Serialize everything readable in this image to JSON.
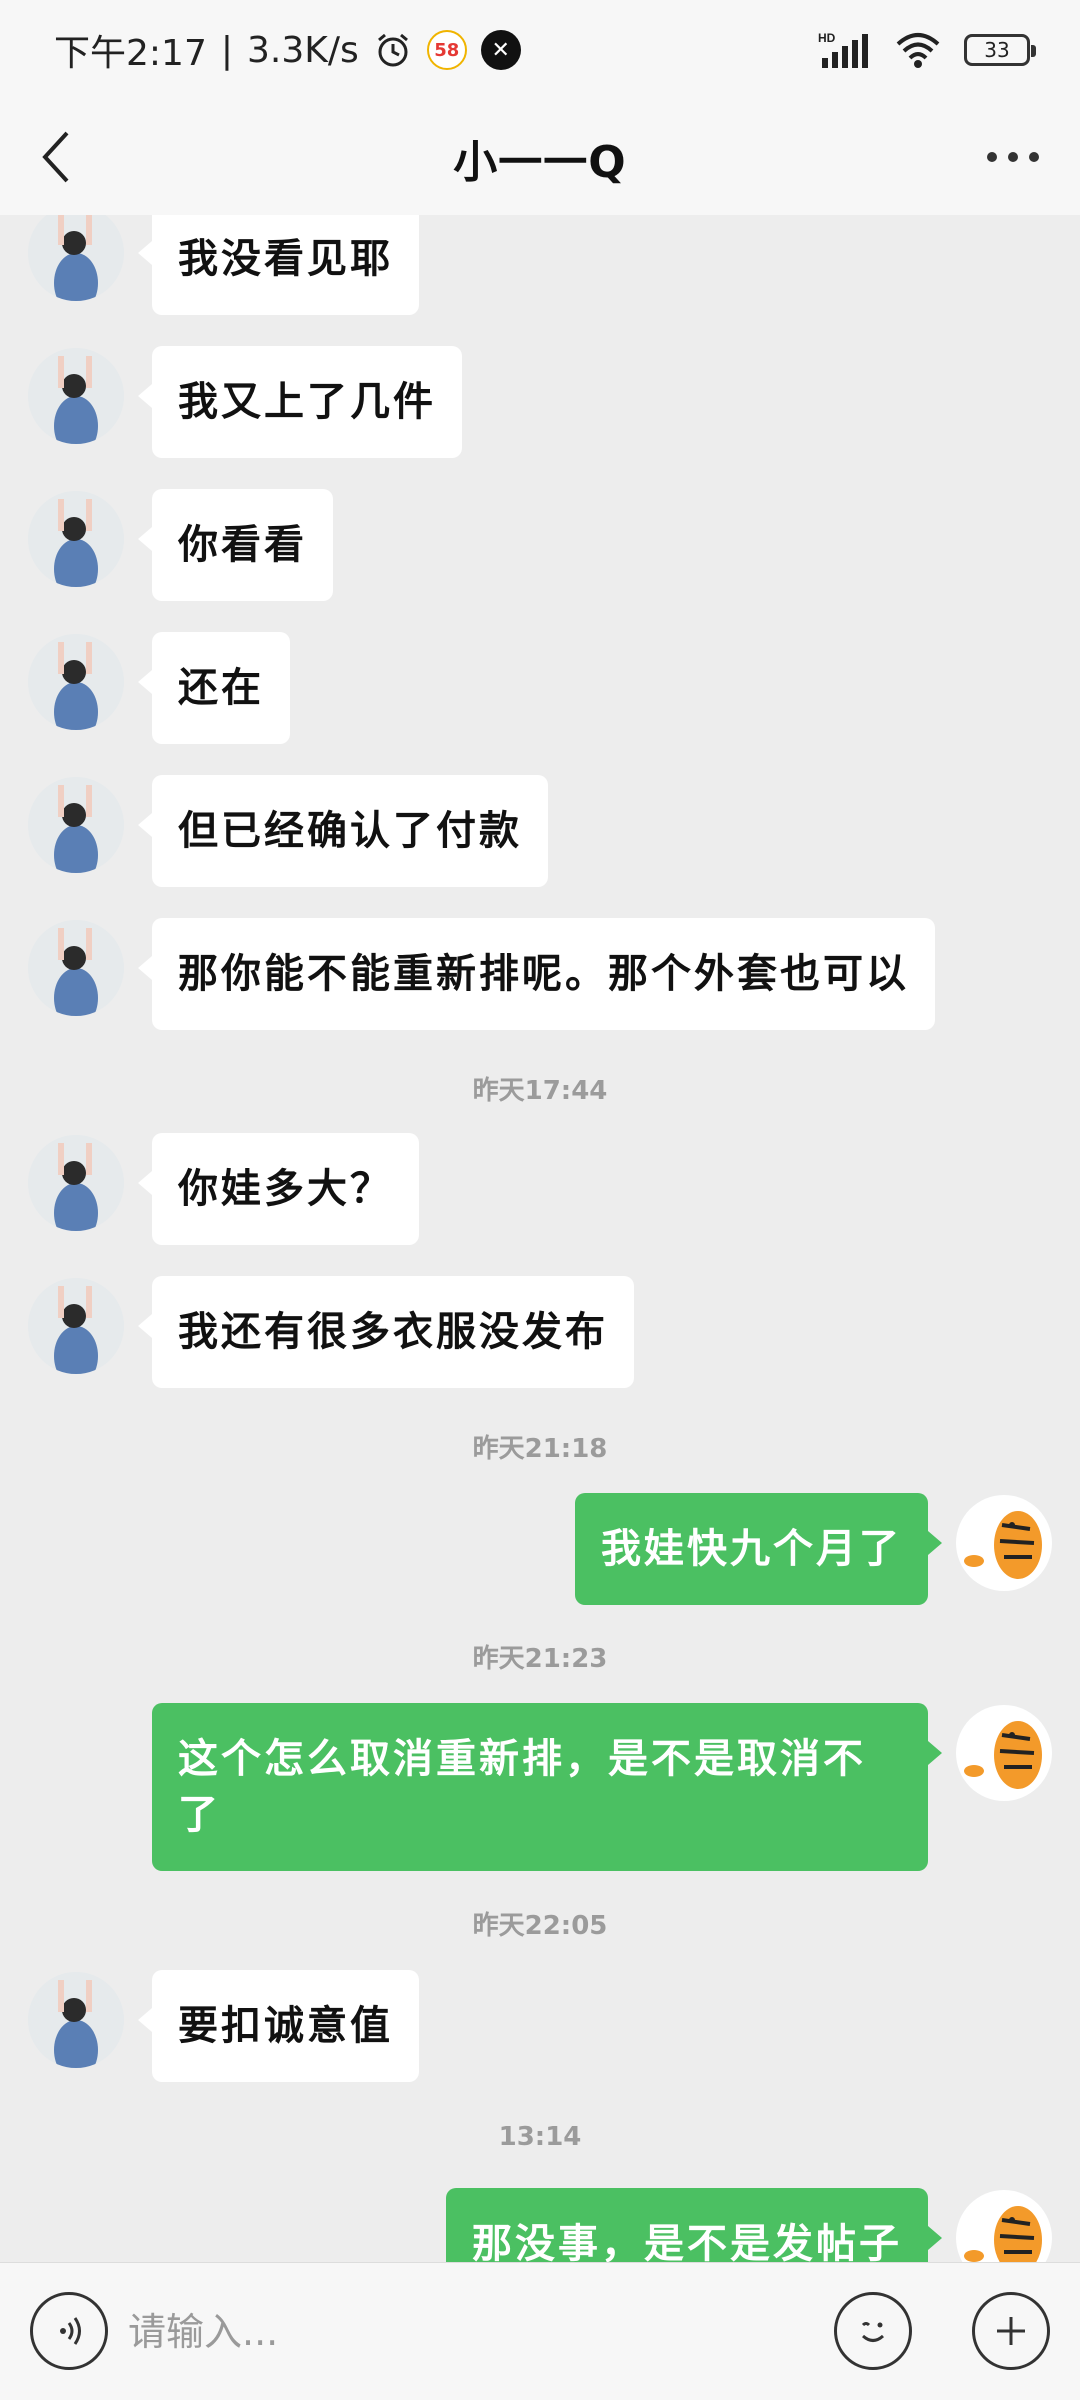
{
  "status_bar": {
    "time": "下午2:17",
    "speed": "3.3K/s",
    "separator": "|",
    "battery": "33",
    "hd": "HD"
  },
  "header": {
    "title": "小一一Q"
  },
  "timestamps": {
    "t1": "昨天17:44",
    "t2": "昨天21:18",
    "t3": "昨天21:23",
    "t4": "昨天22:05",
    "t5": "13:14"
  },
  "messages": [
    {
      "side": "left",
      "text": "我没看见耶"
    },
    {
      "side": "left",
      "text": "我又上了几件"
    },
    {
      "side": "left",
      "text": "你看看"
    },
    {
      "side": "left",
      "text": "还在"
    },
    {
      "side": "left",
      "text": "但已经确认了付款"
    },
    {
      "side": "left",
      "text": "那你能不能重新排呢。那个外套也可以"
    },
    {
      "side": "left",
      "text": "你娃多大？"
    },
    {
      "side": "left",
      "text": "我还有很多衣服没发布"
    },
    {
      "side": "right",
      "text": "我娃快九个月了"
    },
    {
      "side": "right",
      "text": "这个怎么取消重新排，是不是取消不了"
    },
    {
      "side": "left",
      "text": "要扣诚意值"
    },
    {
      "side": "right",
      "text": "那没事，是不是发帖子"
    }
  ],
  "input": {
    "placeholder": "请输入..."
  },
  "icons": {
    "back": "back-arrow-icon",
    "more": "more-dots-icon",
    "voice": "voice-icon",
    "emoji": "emoji-icon",
    "plus": "plus-icon"
  },
  "colors": {
    "sent_bubble": "#4bc062",
    "received_bubble": "#ffffff",
    "background": "#ededed"
  }
}
